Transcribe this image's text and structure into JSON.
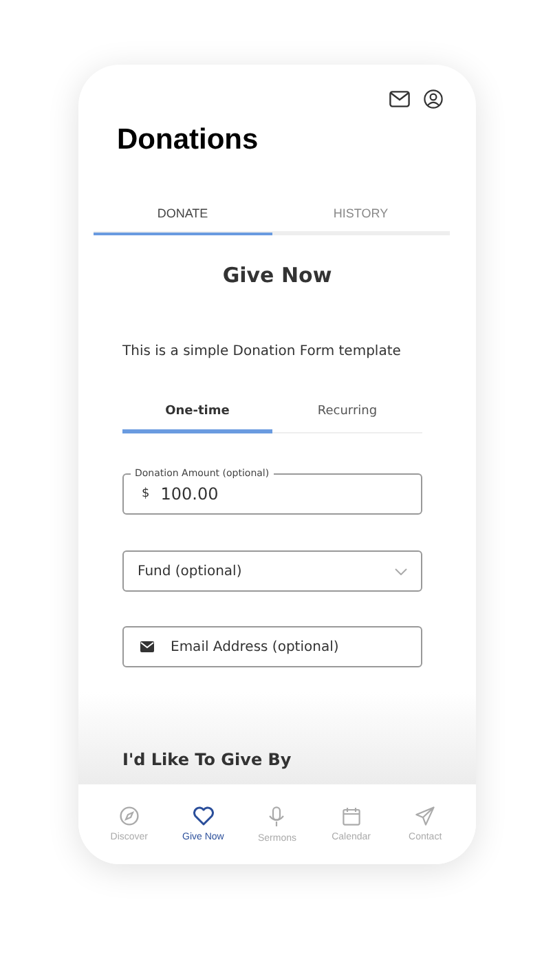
{
  "header": {
    "title": "Donations"
  },
  "tabs": [
    {
      "label": "DONATE",
      "selected": true
    },
    {
      "label": "HISTORY",
      "selected": false
    }
  ],
  "form": {
    "title": "Give Now",
    "description": "This is a simple Donation Form template",
    "frequency": [
      {
        "label": "One-time",
        "selected": true
      },
      {
        "label": "Recurring",
        "selected": false
      }
    ],
    "amount": {
      "label": "Donation Amount  (optional)",
      "currency": "$",
      "value": "100.00"
    },
    "fund": {
      "placeholder": "Fund  (optional)"
    },
    "email": {
      "placeholder": "Email Address  (optional)"
    },
    "section_title": "I'd Like To Give By"
  },
  "bottom_nav": [
    {
      "kind": "compass",
      "label": "Discover",
      "selected": false
    },
    {
      "kind": "heart",
      "label": "Give Now",
      "selected": true
    },
    {
      "kind": "mic",
      "label": "Sermons",
      "selected": false
    },
    {
      "kind": "calendar",
      "label": "Calendar",
      "selected": false
    },
    {
      "kind": "send",
      "label": "Contact",
      "selected": false
    }
  ]
}
